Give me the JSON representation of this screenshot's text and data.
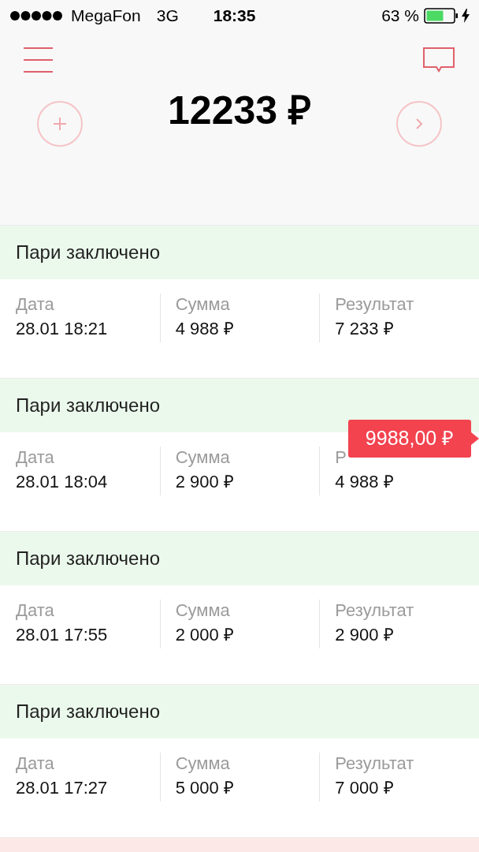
{
  "status_bar": {
    "carrier": "MegaFon",
    "network": "3G",
    "time": "18:35",
    "battery": "63 %"
  },
  "balance": "12233 ₽",
  "bets": [
    {
      "kind": "won",
      "status": "Пари заключено",
      "fields": [
        {
          "label": "Дата",
          "value": "28.01 18:21"
        },
        {
          "label": "Сумма",
          "value": "4 988 ₽"
        },
        {
          "label": "Результат",
          "value": "7 233 ₽"
        }
      ]
    },
    {
      "kind": "won",
      "status": "Пари заключено",
      "fields": [
        {
          "label": "Дата",
          "value": "28.01 18:04"
        },
        {
          "label": "Сумма",
          "value": "2 900 ₽"
        },
        {
          "label": "Р",
          "value": "4 988 ₽"
        }
      ],
      "tooltip": "9988,00 ₽"
    },
    {
      "kind": "won",
      "status": "Пари заключено",
      "fields": [
        {
          "label": "Дата",
          "value": "28.01 17:55"
        },
        {
          "label": "Сумма",
          "value": "2 000 ₽"
        },
        {
          "label": "Результат",
          "value": "2 900 ₽"
        }
      ]
    },
    {
      "kind": "won",
      "status": "Пари заключено",
      "fields": [
        {
          "label": "Дата",
          "value": "28.01 17:27"
        },
        {
          "label": "Сумма",
          "value": "5 000 ₽"
        },
        {
          "label": "Результат",
          "value": "7 000 ₽"
        }
      ]
    },
    {
      "kind": "lost"
    }
  ]
}
